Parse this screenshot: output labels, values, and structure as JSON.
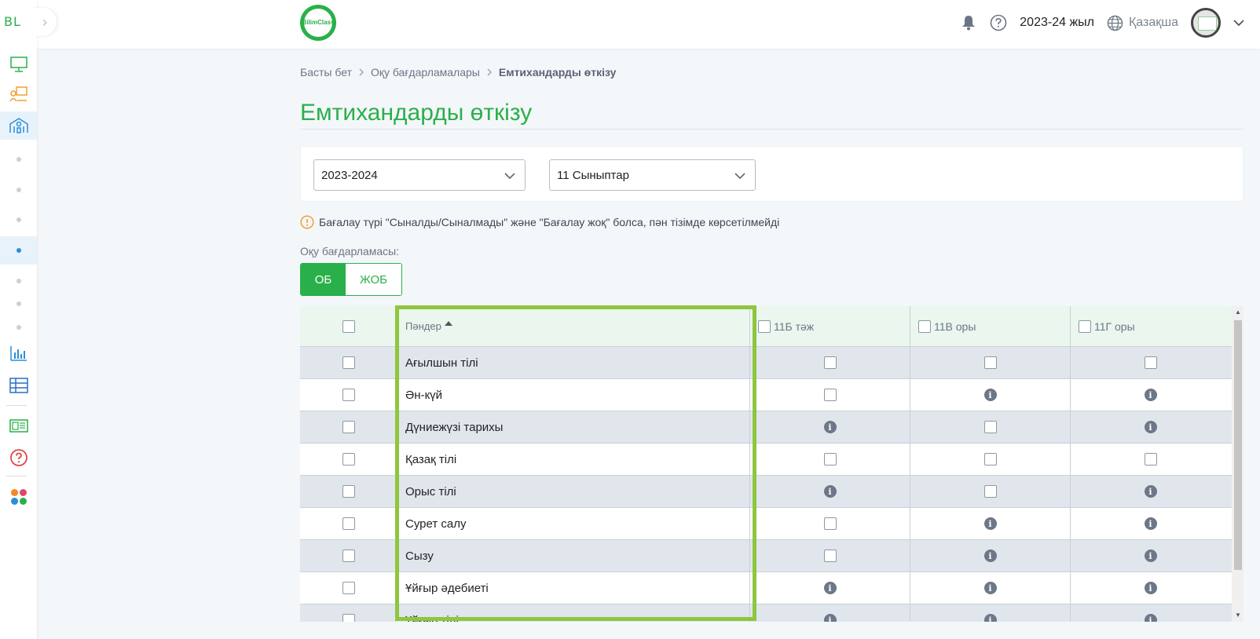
{
  "sidebar": {
    "logo_text": "BL",
    "toggle_glyph": "›",
    "icons": [
      "monitor-icon",
      "classroom-icon",
      "school-icon",
      "chart-icon",
      "table-icon",
      "journal-icon",
      "help-icon",
      "apps-icon"
    ]
  },
  "header": {
    "brand_line1": "Bilim",
    "brand_line2": "Class",
    "year": "2023-24 жыл",
    "language": "Қазақша"
  },
  "breadcrumb": {
    "home": "Басты бет",
    "programs": "Оқу бағдарламалары",
    "current": "Емтихандарды өткізу"
  },
  "page": {
    "title": "Емтихандарды өткізу"
  },
  "filters": {
    "year_value": "2023-2024",
    "class_value": "11 Сыныптар"
  },
  "notice": "Бағалау түрі \"Сыналды/Сыналмады\" және \"Бағалау жоқ\" болса, пән тізімде көрсетілмейді",
  "program": {
    "label": "Оқу бағдарламасы:",
    "options": [
      "ОБ",
      "ЖОБ"
    ],
    "selected": "ОБ"
  },
  "table": {
    "headers": {
      "subjects": "Пәндер",
      "classes": [
        "11Б тәж",
        "11В оры",
        "11Г оры"
      ]
    },
    "rows": [
      {
        "subject": "Ағылшын тілі",
        "cells": [
          "checkbox",
          "checkbox",
          "checkbox"
        ]
      },
      {
        "subject": "Ән-күй",
        "cells": [
          "checkbox",
          "info",
          "info"
        ]
      },
      {
        "subject": "Дүниежүзі тарихы",
        "cells": [
          "info",
          "checkbox",
          "info"
        ]
      },
      {
        "subject": "Қазақ тілі",
        "cells": [
          "checkbox",
          "checkbox",
          "checkbox"
        ]
      },
      {
        "subject": "Орыс тілі",
        "cells": [
          "info",
          "checkbox",
          "info"
        ]
      },
      {
        "subject": "Сурет салу",
        "cells": [
          "checkbox",
          "info",
          "info"
        ]
      },
      {
        "subject": "Сызу",
        "cells": [
          "checkbox",
          "info",
          "info"
        ]
      },
      {
        "subject": "Ұйғыр әдебиеті",
        "cells": [
          "info",
          "info",
          "info"
        ]
      },
      {
        "subject": "Ұйғыр тілі",
        "cells": [
          "info",
          "info",
          "info"
        ]
      }
    ],
    "info_glyph": "i"
  },
  "colors": {
    "brand_green": "#2ab04a",
    "highlight_border": "#8ec63f",
    "header_row_bg": "#eaf6ee",
    "odd_row_bg": "#e1e6ed"
  }
}
